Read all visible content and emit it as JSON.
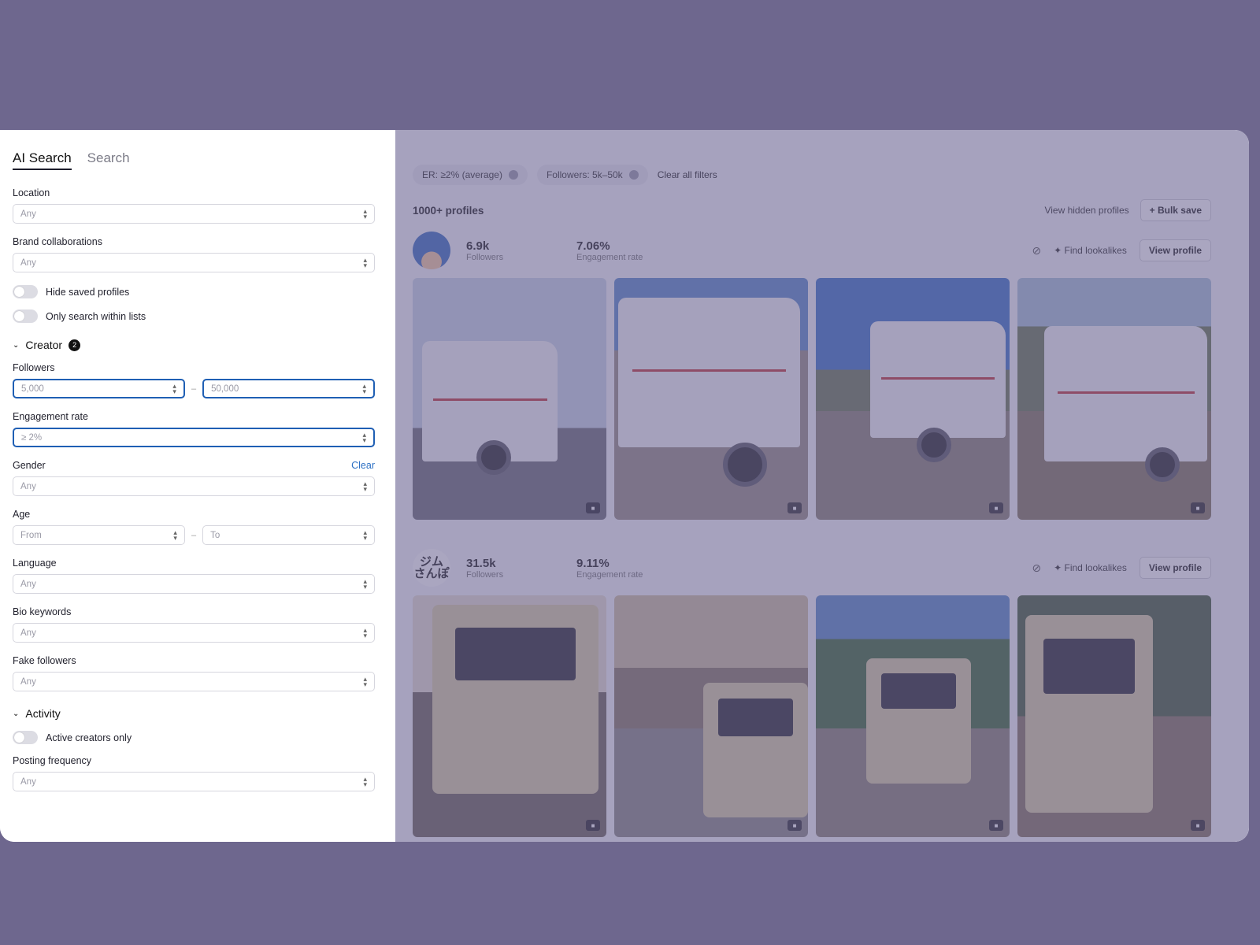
{
  "tabs": [
    {
      "label": "AI Search"
    },
    {
      "label": "Search"
    }
  ],
  "filters": {
    "location": {
      "label": "Location",
      "value": "Any"
    },
    "brand": {
      "label": "Brand collaborations",
      "value": "Any"
    },
    "toggles": {
      "hide_saved": "Hide saved profiles",
      "only_lists": "Only search within lists"
    },
    "creator": {
      "title": "Creator",
      "count": "2",
      "followers": {
        "label": "Followers",
        "min": "5,000",
        "max": "50,000"
      },
      "engagement": {
        "label": "Engagement rate",
        "value": "≥ 2%"
      },
      "gender": {
        "label": "Gender",
        "clear": "Clear",
        "value": "Any"
      },
      "age": {
        "label": "Age",
        "from": "From",
        "to": "To"
      },
      "language": {
        "label": "Language",
        "value": "Any"
      },
      "bio": {
        "label": "Bio keywords",
        "value": "Any"
      },
      "fake": {
        "label": "Fake followers",
        "value": "Any"
      }
    },
    "activity": {
      "title": "Activity",
      "active_only": "Active creators only",
      "posting": {
        "label": "Posting frequency",
        "value": "Any"
      }
    }
  },
  "chips": [
    {
      "label": "ER: ≥2% (average)"
    },
    {
      "label": "Followers: 5k–50k"
    }
  ],
  "clear_all": "Clear all filters",
  "results": {
    "count": "1000+ profiles",
    "view_hidden": "View hidden profiles",
    "bulk_save": "+ Bulk save"
  },
  "profiles": [
    {
      "followers": "6.9k",
      "followers_label": "Followers",
      "er": "7.06%",
      "er_label": "Engagement rate",
      "lookalikes": "Find lookalikes",
      "view": "View profile"
    },
    {
      "avatar_text": "ジム\nさんぽ",
      "followers": "31.5k",
      "followers_label": "Followers",
      "er": "9.11%",
      "er_label": "Engagement rate",
      "lookalikes": "Find lookalikes",
      "view": "View profile"
    }
  ],
  "colors": {
    "backdrop": "#6e678e",
    "accent": "#1f5fb4",
    "overlay": "rgba(100,92,140,0.55)"
  },
  "icons": [
    "chevron-updown-icon",
    "chevron-down-icon",
    "hide-eye-icon",
    "sparkle-icon",
    "video-icon"
  ]
}
